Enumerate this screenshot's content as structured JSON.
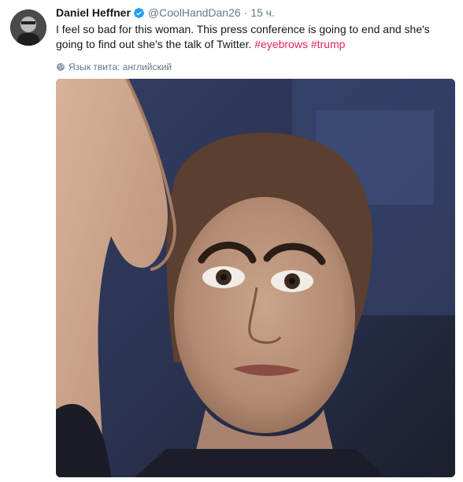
{
  "tweet": {
    "author_name": "Daniel Heffner",
    "handle": "@CoolHandDan26",
    "separator": "·",
    "time": "15 ч.",
    "text_main": "I feel so bad for this woman. This press conference is going to end and she's going to find out she's the talk of Twitter. ",
    "hashtag_1": "#eyebrows",
    "hashtag_2": "#trump",
    "language_note": "Язык твита: английский"
  },
  "icons": {
    "verified": "verified-badge-icon",
    "language": "globe-icon"
  },
  "colors": {
    "hashtag": "#e0245e",
    "verified": "#1da1f2",
    "muted": "#657786"
  }
}
